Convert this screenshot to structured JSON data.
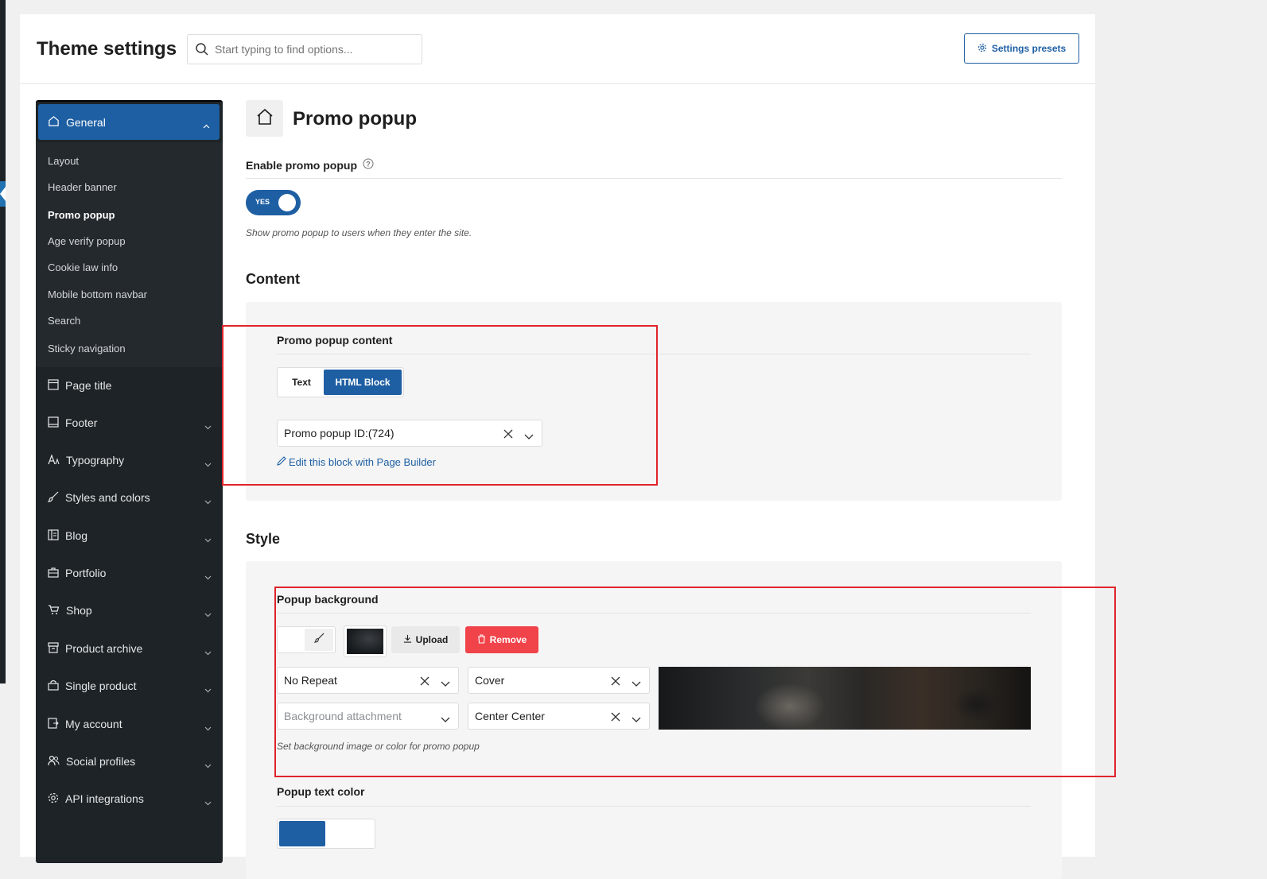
{
  "header": {
    "title": "Theme settings",
    "search_placeholder": "Start typing to find options...",
    "presets_label": "Settings presets"
  },
  "sidebar": {
    "general_label": "General",
    "sub_items": [
      {
        "label": "Layout"
      },
      {
        "label": "Header banner"
      },
      {
        "label": "Promo popup",
        "active": true
      },
      {
        "label": "Age verify popup"
      },
      {
        "label": "Cookie law info"
      },
      {
        "label": "Mobile bottom navbar"
      },
      {
        "label": "Search"
      },
      {
        "label": "Sticky navigation"
      }
    ],
    "items": [
      {
        "label": "Page title",
        "icon": "page-title-icon",
        "has_chevron": false
      },
      {
        "label": "Footer",
        "icon": "footer-icon",
        "has_chevron": true
      },
      {
        "label": "Typography",
        "icon": "typography-icon",
        "has_chevron": true
      },
      {
        "label": "Styles and colors",
        "icon": "brush-icon",
        "has_chevron": true
      },
      {
        "label": "Blog",
        "icon": "blog-icon",
        "has_chevron": true
      },
      {
        "label": "Portfolio",
        "icon": "briefcase-icon",
        "has_chevron": true
      },
      {
        "label": "Shop",
        "icon": "cart-icon",
        "has_chevron": true
      },
      {
        "label": "Product archive",
        "icon": "archive-icon",
        "has_chevron": true
      },
      {
        "label": "Single product",
        "icon": "bag-icon",
        "has_chevron": true
      },
      {
        "label": "My account",
        "icon": "account-icon",
        "has_chevron": true
      },
      {
        "label": "Social profiles",
        "icon": "users-icon",
        "has_chevron": true
      },
      {
        "label": "API integrations",
        "icon": "gear-icon",
        "has_chevron": true
      }
    ]
  },
  "main": {
    "section_title": "Promo popup",
    "enable_label": "Enable promo popup",
    "toggle_label": "YES",
    "enable_hint": "Show promo popup to users when they enter the site.",
    "content_heading": "Content",
    "content_field_label": "Promo popup content",
    "content_options": [
      "Text",
      "HTML Block"
    ],
    "content_selected": "HTML Block",
    "block_select_value": "Promo popup ID:(724)",
    "edit_link": "Edit this block with Page Builder",
    "style_heading": "Style",
    "bg_label": "Popup background",
    "upload_label": "Upload",
    "remove_label": "Remove",
    "repeat_value": "No Repeat",
    "size_value": "Cover",
    "attachment_placeholder": "Background attachment",
    "position_value": "Center Center",
    "bg_hint": "Set background image or color for promo popup",
    "text_color_label": "Popup text color"
  },
  "colors": {
    "accent": "#1e5fa3",
    "sidebar_bg": "#1d2327",
    "remove": "#f0434a",
    "annotation": "#e0242b"
  }
}
